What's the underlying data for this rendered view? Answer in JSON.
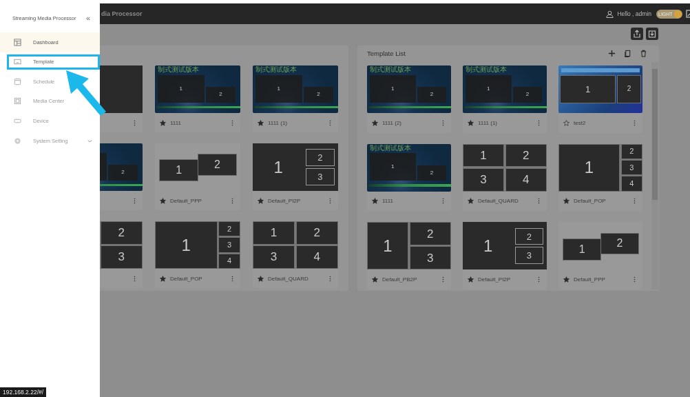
{
  "header": {
    "title": "dia Processor",
    "greeting": "Hello , admin",
    "theme_toggle": {
      "label": "LIGHT",
      "on": true
    }
  },
  "sidebar": {
    "title": "Streaming Media Processor",
    "collapse_glyph": "«",
    "items": [
      {
        "label": "Dashboard",
        "hovered": true,
        "highlighted": false,
        "expandable": false
      },
      {
        "label": "Template",
        "hovered": false,
        "highlighted": true,
        "expandable": false
      },
      {
        "label": "Schedule",
        "hovered": false,
        "highlighted": false,
        "expandable": false
      },
      {
        "label": "Media Center",
        "hovered": false,
        "highlighted": false,
        "expandable": false
      },
      {
        "label": "Device",
        "hovered": false,
        "highlighted": false,
        "expandable": false
      },
      {
        "label": "System Setting",
        "hovered": false,
        "highlighted": false,
        "expandable": true
      }
    ]
  },
  "status_url": "192.168.2.22/#/",
  "left_panel": {
    "cards": [
      {
        "kind": "blank"
      },
      {
        "kind": "theme",
        "caption": "制式测试版本",
        "cells": [
          "1",
          "2"
        ],
        "name": "1111",
        "starred": true
      },
      {
        "kind": "theme",
        "caption": "制式测试版本",
        "cells": [
          "1",
          "2"
        ],
        "name": "1111 (1)",
        "starred": true
      },
      {
        "kind": "theme",
        "cells": [
          null,
          "2"
        ]
      },
      {
        "kind": "ppp",
        "cells": [
          "1",
          "2"
        ],
        "name": "Default_PPP",
        "starred": true
      },
      {
        "kind": "pi2p",
        "cells": [
          "1",
          "2",
          "3"
        ],
        "name": "Default_PI2P",
        "starred": true
      },
      {
        "kind": "pb2p",
        "cells": [
          null,
          "2",
          "3"
        ]
      },
      {
        "kind": "pop",
        "cells": [
          "1",
          "2",
          "3",
          "4"
        ],
        "name": "Default_POP",
        "starred": true
      },
      {
        "kind": "quard",
        "cells": [
          "1",
          "2",
          "3",
          "4"
        ],
        "name": "Default_QUARD",
        "starred": true
      }
    ]
  },
  "right_panel": {
    "title": "Template List",
    "cards": [
      {
        "kind": "theme",
        "caption": "制式测试版本",
        "cells": [
          "1",
          "2"
        ],
        "name": "1111 (2)",
        "starred": true
      },
      {
        "kind": "theme",
        "caption": "制式测试版本",
        "cells": [
          "1",
          "2"
        ],
        "name": "1111 (1)",
        "starred": true
      },
      {
        "kind": "theme2",
        "cells": [
          "1",
          "2"
        ],
        "name": "test2",
        "starred": false
      },
      {
        "kind": "theme",
        "caption": "制式测试版本",
        "cells": [
          "1",
          "2"
        ],
        "name": "1111",
        "starred": true
      },
      {
        "kind": "quard",
        "cells": [
          "1",
          "2",
          "3",
          "4"
        ],
        "name": "Default_QUARD",
        "starred": true
      },
      {
        "kind": "pop",
        "cells": [
          "1",
          "2",
          "3",
          "4"
        ],
        "name": "Default_POP",
        "starred": true
      },
      {
        "kind": "pb2p",
        "cells": [
          "1",
          "2",
          "3"
        ],
        "name": "Default_PB2P",
        "starred": true
      },
      {
        "kind": "pi2p",
        "cells": [
          "1",
          "2",
          "3"
        ],
        "name": "Default_PI2P",
        "starred": true
      },
      {
        "kind": "ppp",
        "cells": [
          "1",
          "2"
        ],
        "name": "Default_PPP",
        "starred": true
      }
    ]
  }
}
